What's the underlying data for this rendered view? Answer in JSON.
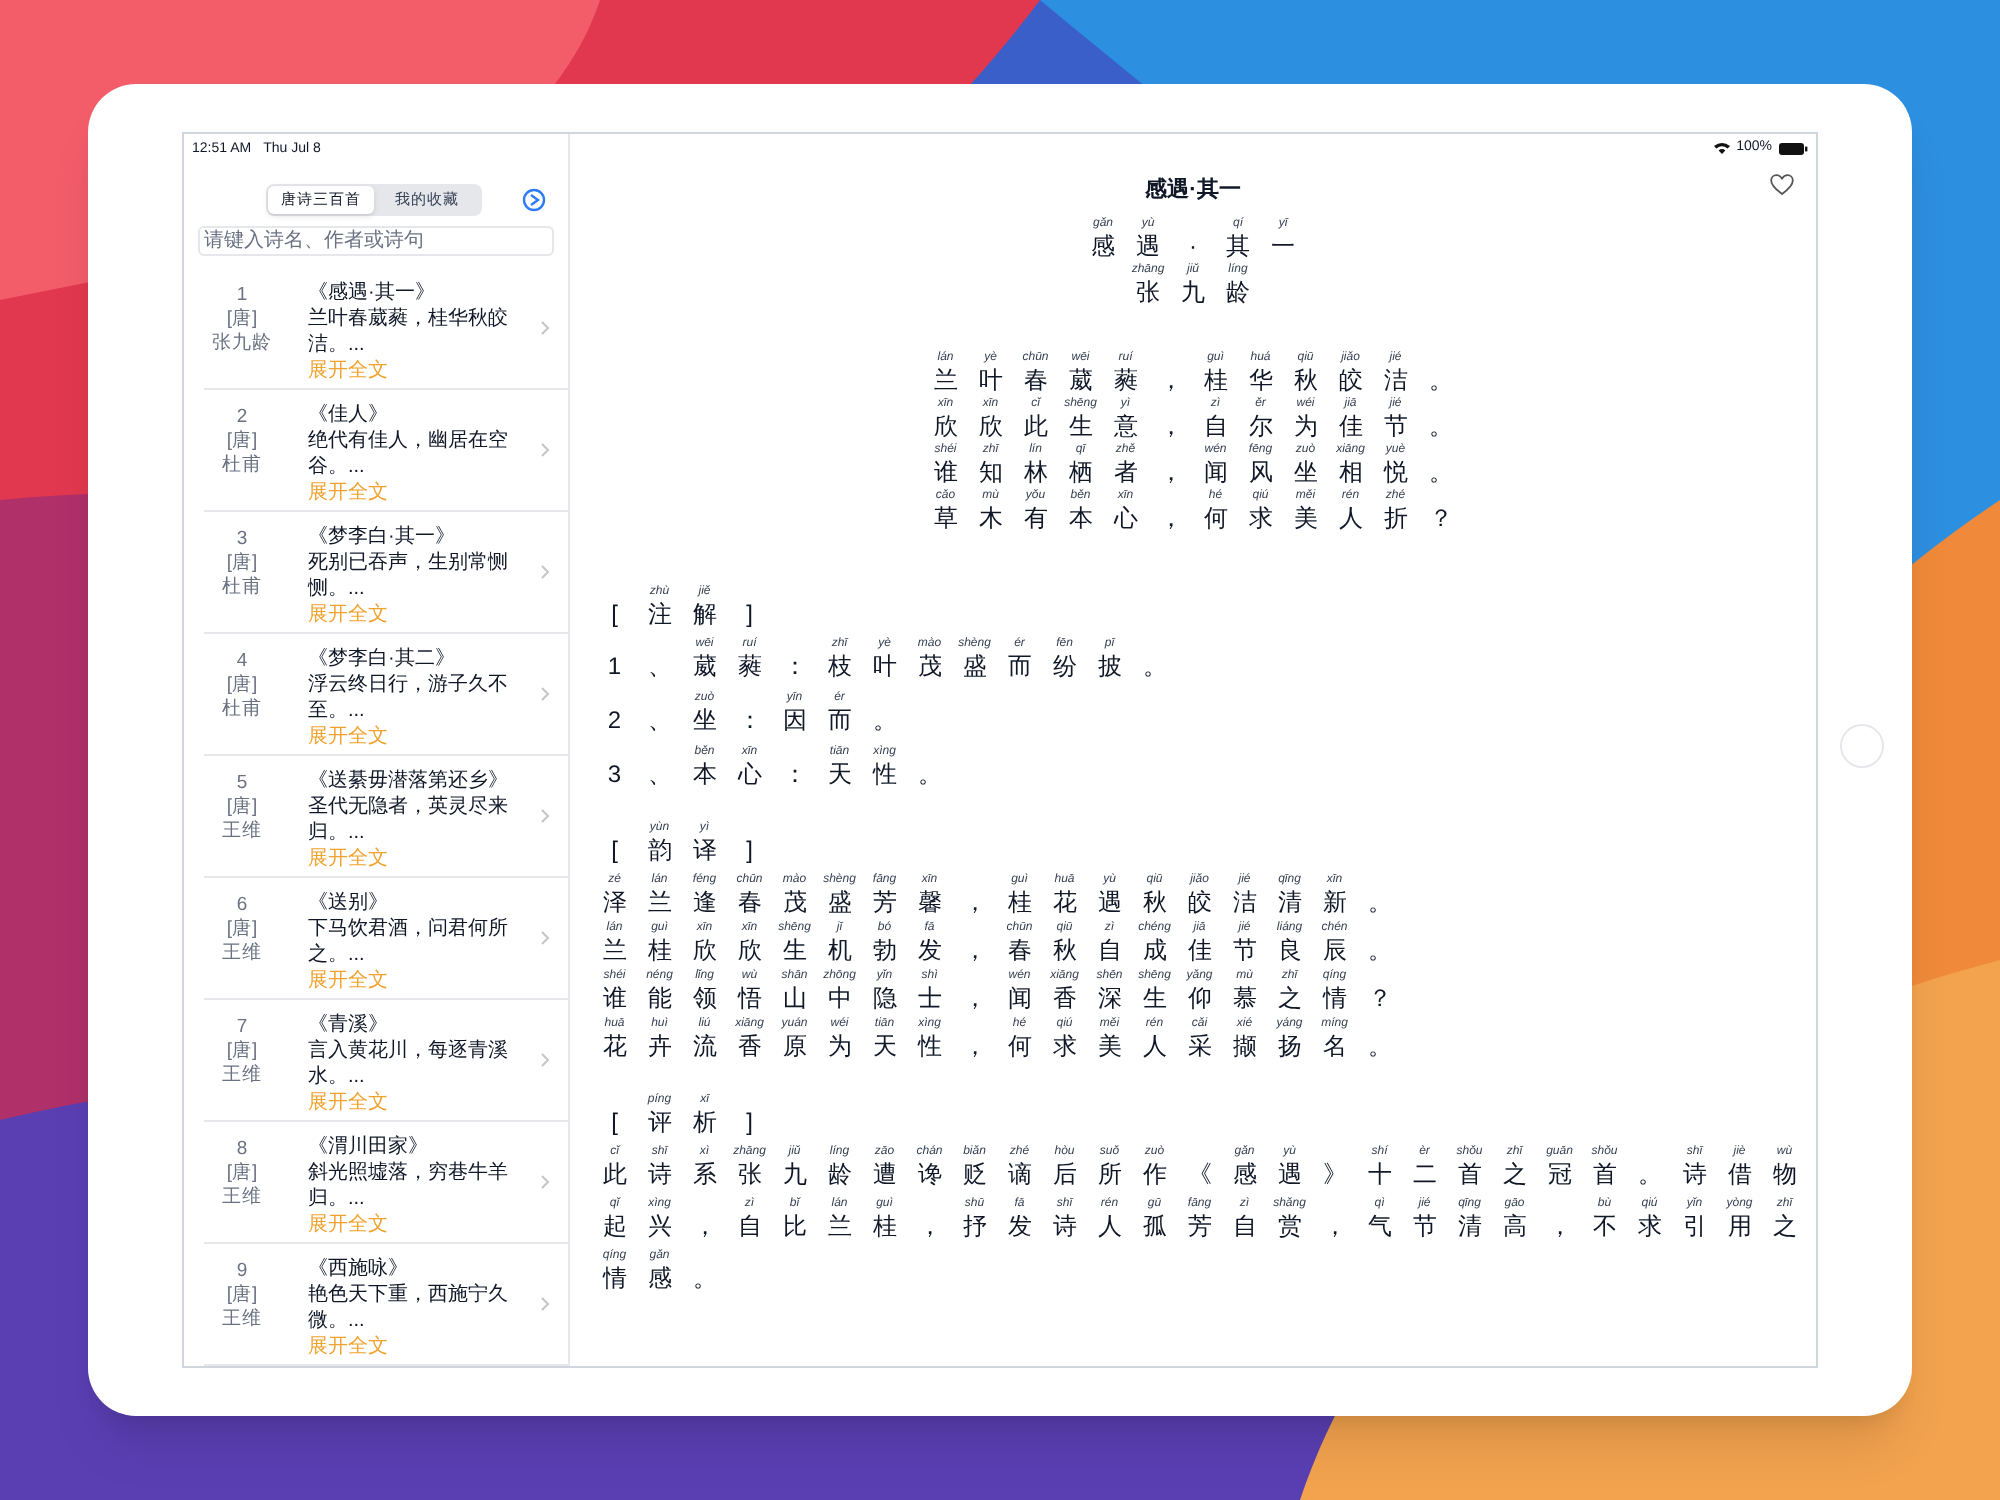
{
  "status_bar": {
    "time": "12:51 AM",
    "date": "Thu Jul 8",
    "battery": "100%"
  },
  "sidebar": {
    "tabs": [
      {
        "label": "唐诗三百首",
        "selected": true
      },
      {
        "label": "我的收藏",
        "selected": false
      }
    ],
    "search": {
      "placeholder": "请键入诗名、作者或诗句"
    },
    "poems": [
      {
        "number": "1",
        "dynasty": "[唐]",
        "author": "张九龄",
        "title": "《感遇·其一》",
        "excerpt": "兰叶春葳蕤，桂华秋皎洁。...",
        "expand": "展开全文"
      },
      {
        "number": "2",
        "dynasty": "[唐]",
        "author": "杜甫",
        "title": "《佳人》",
        "excerpt": "绝代有佳人，幽居在空谷。...",
        "expand": "展开全文"
      },
      {
        "number": "3",
        "dynasty": "[唐]",
        "author": "杜甫",
        "title": "《梦李白·其一》",
        "excerpt": "死别已吞声，生别常恻恻。...",
        "expand": "展开全文"
      },
      {
        "number": "4",
        "dynasty": "[唐]",
        "author": "杜甫",
        "title": "《梦李白·其二》",
        "excerpt": "浮云终日行，游子久不至。...",
        "expand": "展开全文"
      },
      {
        "number": "5",
        "dynasty": "[唐]",
        "author": "王维",
        "title": "《送綦毋潜落第还乡》",
        "excerpt": "圣代无隐者，英灵尽来归。...",
        "expand": "展开全文"
      },
      {
        "number": "6",
        "dynasty": "[唐]",
        "author": "王维",
        "title": "《送别》",
        "excerpt": "下马饮君酒，问君何所之。...",
        "expand": "展开全文"
      },
      {
        "number": "7",
        "dynasty": "[唐]",
        "author": "王维",
        "title": "《青溪》",
        "excerpt": "言入黄花川，每逐青溪水。...",
        "expand": "展开全文"
      },
      {
        "number": "8",
        "dynasty": "[唐]",
        "author": "王维",
        "title": "《渭川田家》",
        "excerpt": "斜光照墟落，穷巷牛羊归。...",
        "expand": "展开全文"
      },
      {
        "number": "9",
        "dynasty": "[唐]",
        "author": "王维",
        "title": "《西施咏》",
        "excerpt": "艳色天下重，西施宁久微。...",
        "expand": "展开全文"
      }
    ]
  },
  "detail": {
    "title": "感遇·其一",
    "favorited": false,
    "heading": [
      [
        "gǎn",
        "感"
      ],
      [
        "yù",
        "遇"
      ],
      [
        "·"
      ],
      [
        "qí",
        "其"
      ],
      [
        "yī",
        "一"
      ]
    ],
    "author": [
      [
        "zhāng",
        "张"
      ],
      [
        "jiǔ",
        "九"
      ],
      [
        "líng",
        "龄"
      ]
    ],
    "poem": [
      [
        [
          "lán",
          "兰"
        ],
        [
          "yè",
          "叶"
        ],
        [
          "chūn",
          "春"
        ],
        [
          "wēi",
          "葳"
        ],
        [
          "ruí",
          "蕤"
        ],
        [
          "，"
        ],
        [
          "guì",
          "桂"
        ],
        [
          "huá",
          "华"
        ],
        [
          "qiū",
          "秋"
        ],
        [
          "jiǎo",
          "皎"
        ],
        [
          "jié",
          "洁"
        ],
        [
          "。"
        ]
      ],
      [
        [
          "xīn",
          "欣"
        ],
        [
          "xīn",
          "欣"
        ],
        [
          "cǐ",
          "此"
        ],
        [
          "shēng",
          "生"
        ],
        [
          "yì",
          "意"
        ],
        [
          "，"
        ],
        [
          "zì",
          "自"
        ],
        [
          "ěr",
          "尔"
        ],
        [
          "wéi",
          "为"
        ],
        [
          "jiā",
          "佳"
        ],
        [
          "jié",
          "节"
        ],
        [
          "。"
        ]
      ],
      [
        [
          "shéi",
          "谁"
        ],
        [
          "zhī",
          "知"
        ],
        [
          "lín",
          "林"
        ],
        [
          "qī",
          "栖"
        ],
        [
          "zhě",
          "者"
        ],
        [
          "，"
        ],
        [
          "wén",
          "闻"
        ],
        [
          "fēng",
          "风"
        ],
        [
          "zuò",
          "坐"
        ],
        [
          "xiāng",
          "相"
        ],
        [
          "yuè",
          "悦"
        ],
        [
          "。"
        ]
      ],
      [
        [
          "cǎo",
          "草"
        ],
        [
          "mù",
          "木"
        ],
        [
          "yǒu",
          "有"
        ],
        [
          "běn",
          "本"
        ],
        [
          "xīn",
          "心"
        ],
        [
          "，"
        ],
        [
          "hé",
          "何"
        ],
        [
          "qiú",
          "求"
        ],
        [
          "měi",
          "美"
        ],
        [
          "rén",
          "人"
        ],
        [
          "zhé",
          "折"
        ],
        [
          "？"
        ]
      ]
    ],
    "sections": [
      {
        "kind": "rows",
        "header": [
          [
            "["
          ],
          [
            "zhù",
            "注"
          ],
          [
            "jiě",
            "解"
          ],
          [
            "]"
          ]
        ],
        "lines": [
          [
            [
              "1"
            ],
            [
              "、"
            ],
            [
              "wēi",
              "葳"
            ],
            [
              "ruí",
              "蕤"
            ],
            [
              "："
            ],
            [
              "zhī",
              "枝"
            ],
            [
              "yè",
              "叶"
            ],
            [
              "mào",
              "茂"
            ],
            [
              "shèng",
              "盛"
            ],
            [
              "ér",
              "而"
            ],
            [
              "fēn",
              "纷"
            ],
            [
              "pī",
              "披"
            ],
            [
              "。"
            ]
          ],
          [
            [
              "2"
            ],
            [
              "、"
            ],
            [
              "zuò",
              "坐"
            ],
            [
              "："
            ],
            [
              "yīn",
              "因"
            ],
            [
              "ér",
              "而"
            ],
            [
              "。"
            ]
          ],
          [
            [
              "3"
            ],
            [
              "、"
            ],
            [
              "běn",
              "本"
            ],
            [
              "xīn",
              "心"
            ],
            [
              "："
            ],
            [
              "tiān",
              "天"
            ],
            [
              "xìng",
              "性"
            ],
            [
              "。"
            ]
          ]
        ]
      },
      {
        "kind": "rows",
        "header": [
          [
            "["
          ],
          [
            "yùn",
            "韵"
          ],
          [
            "yì",
            "译"
          ],
          [
            "]"
          ]
        ],
        "lines": [
          [
            [
              "zé",
              "泽"
            ],
            [
              "lán",
              "兰"
            ],
            [
              "féng",
              "逢"
            ],
            [
              "chūn",
              "春"
            ],
            [
              "mào",
              "茂"
            ],
            [
              "shèng",
              "盛"
            ],
            [
              "fāng",
              "芳"
            ],
            [
              "xīn",
              "馨"
            ],
            [
              "，"
            ],
            [
              "guì",
              "桂"
            ],
            [
              "huā",
              "花"
            ],
            [
              "yù",
              "遇"
            ],
            [
              "qiū",
              "秋"
            ],
            [
              "jiǎo",
              "皎"
            ],
            [
              "jié",
              "洁"
            ],
            [
              "qīng",
              "清"
            ],
            [
              "xīn",
              "新"
            ],
            [
              "。"
            ]
          ],
          [
            [
              "lán",
              "兰"
            ],
            [
              "guì",
              "桂"
            ],
            [
              "xīn",
              "欣"
            ],
            [
              "xīn",
              "欣"
            ],
            [
              "shēng",
              "生"
            ],
            [
              "jī",
              "机"
            ],
            [
              "bó",
              "勃"
            ],
            [
              "fā",
              "发"
            ],
            [
              "，"
            ],
            [
              "chūn",
              "春"
            ],
            [
              "qiū",
              "秋"
            ],
            [
              "zì",
              "自"
            ],
            [
              "chéng",
              "成"
            ],
            [
              "jiā",
              "佳"
            ],
            [
              "jié",
              "节"
            ],
            [
              "liáng",
              "良"
            ],
            [
              "chén",
              "辰"
            ],
            [
              "。"
            ]
          ],
          [
            [
              "shéi",
              "谁"
            ],
            [
              "néng",
              "能"
            ],
            [
              "lǐng",
              "领"
            ],
            [
              "wù",
              "悟"
            ],
            [
              "shān",
              "山"
            ],
            [
              "zhōng",
              "中"
            ],
            [
              "yǐn",
              "隐"
            ],
            [
              "shì",
              "士"
            ],
            [
              "，"
            ],
            [
              "wén",
              "闻"
            ],
            [
              "xiāng",
              "香"
            ],
            [
              "shēn",
              "深"
            ],
            [
              "shēng",
              "生"
            ],
            [
              "yǎng",
              "仰"
            ],
            [
              "mù",
              "慕"
            ],
            [
              "zhī",
              "之"
            ],
            [
              "qíng",
              "情"
            ],
            [
              "？"
            ]
          ],
          [
            [
              "huā",
              "花"
            ],
            [
              "huì",
              "卉"
            ],
            [
              "liú",
              "流"
            ],
            [
              "xiāng",
              "香"
            ],
            [
              "yuán",
              "原"
            ],
            [
              "wéi",
              "为"
            ],
            [
              "tiān",
              "天"
            ],
            [
              "xìng",
              "性"
            ],
            [
              "，"
            ],
            [
              "hé",
              "何"
            ],
            [
              "qiú",
              "求"
            ],
            [
              "měi",
              "美"
            ],
            [
              "rén",
              "人"
            ],
            [
              "cǎi",
              "采"
            ],
            [
              "xié",
              "撷"
            ],
            [
              "yáng",
              "扬"
            ],
            [
              "míng",
              "名"
            ],
            [
              "。"
            ]
          ]
        ]
      },
      {
        "kind": "flow",
        "header": [
          [
            "["
          ],
          [
            "píng",
            "评"
          ],
          [
            "xī",
            "析"
          ],
          [
            "]"
          ]
        ],
        "lines": [
          [
            [
              "cǐ",
              "此"
            ],
            [
              "shī",
              "诗"
            ],
            [
              "xì",
              "系"
            ],
            [
              "zhāng",
              "张"
            ],
            [
              "jiǔ",
              "九"
            ],
            [
              "líng",
              "龄"
            ],
            [
              "zāo",
              "遭"
            ],
            [
              "chán",
              "谗"
            ],
            [
              "biǎn",
              "贬"
            ],
            [
              "zhé",
              "谪"
            ],
            [
              "hòu",
              "后"
            ],
            [
              "suǒ",
              "所"
            ],
            [
              "zuò",
              "作"
            ],
            [
              "《"
            ],
            [
              "gǎn",
              "感"
            ],
            [
              "yù",
              "遇"
            ],
            [
              "》"
            ],
            [
              "shí",
              "十"
            ],
            [
              "èr",
              "二"
            ],
            [
              "shǒu",
              "首"
            ],
            [
              "zhī",
              "之"
            ],
            [
              "guān",
              "冠"
            ],
            [
              "shǒu",
              "首"
            ],
            [
              "。"
            ],
            [
              "shī",
              "诗"
            ],
            [
              "jiè",
              "借"
            ],
            [
              "wù",
              "物"
            ],
            [
              "qǐ",
              "起"
            ],
            [
              "xìng",
              "兴"
            ],
            [
              "，"
            ],
            [
              "zì",
              "自"
            ],
            [
              "bǐ",
              "比"
            ],
            [
              "lán",
              "兰"
            ],
            [
              "guì",
              "桂"
            ],
            [
              "，"
            ],
            [
              "shū",
              "抒"
            ],
            [
              "fā",
              "发"
            ],
            [
              "shī",
              "诗"
            ],
            [
              "rén",
              "人"
            ],
            [
              "gū",
              "孤"
            ],
            [
              "fāng",
              "芳"
            ],
            [
              "zì",
              "自"
            ],
            [
              "shǎng",
              "赏"
            ],
            [
              "，"
            ],
            [
              "qì",
              "气"
            ],
            [
              "jié",
              "节"
            ],
            [
              "qīng",
              "清"
            ],
            [
              "gāo",
              "高"
            ],
            [
              "，"
            ],
            [
              "bù",
              "不"
            ],
            [
              "qiú",
              "求"
            ],
            [
              "yǐn",
              "引"
            ],
            [
              "yòng",
              "用"
            ],
            [
              "zhī",
              "之"
            ],
            [
              "qíng",
              "情"
            ],
            [
              "gǎn",
              "感"
            ],
            [
              "。"
            ]
          ]
        ]
      }
    ]
  }
}
